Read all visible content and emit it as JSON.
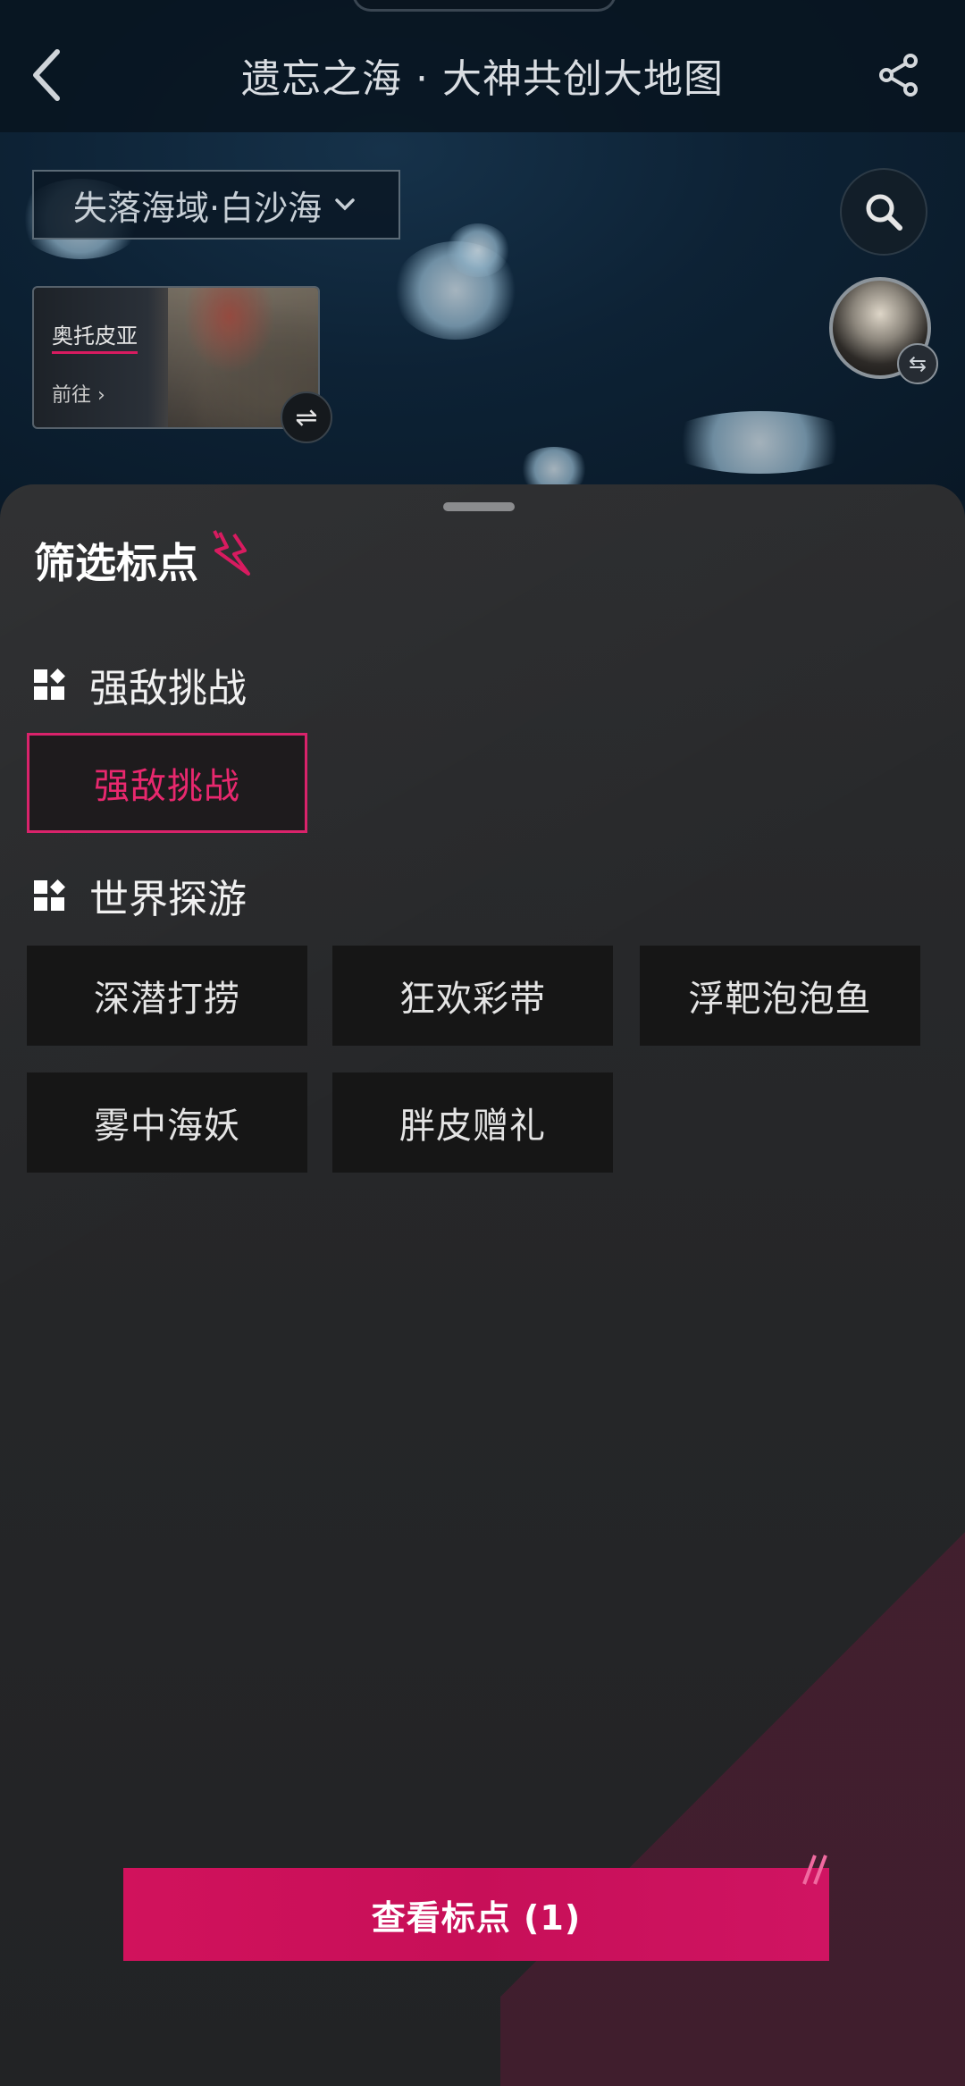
{
  "header": {
    "title": "遗忘之海 · 大神共创大地图"
  },
  "map": {
    "region_select": "失落海域·白沙海",
    "city_card": {
      "name": "奥托皮亚",
      "go_label": "前往"
    }
  },
  "filter_sheet": {
    "title": "筛选标点",
    "sections": [
      {
        "heading": "强敌挑战",
        "items": [
          {
            "label": "强敌挑战",
            "selected": true
          }
        ]
      },
      {
        "heading": "世界探游",
        "items": [
          {
            "label": "深潜打捞",
            "selected": false
          },
          {
            "label": "狂欢彩带",
            "selected": false
          },
          {
            "label": "浮靶泡泡鱼",
            "selected": false
          },
          {
            "label": "雾中海妖",
            "selected": false
          },
          {
            "label": "胖皮赠礼",
            "selected": false
          }
        ]
      }
    ],
    "confirm_button": "查看标点 (1)"
  },
  "colors": {
    "accent": "#d81b60",
    "sheet_bg": "#262729",
    "chip_bg": "#161616",
    "map_bg": "#0d2235"
  },
  "icons": [
    "back-arrow-icon",
    "share-icon",
    "chevron-down-icon",
    "search-icon",
    "swap-icon",
    "grid-icon",
    "bolt-icon"
  ]
}
